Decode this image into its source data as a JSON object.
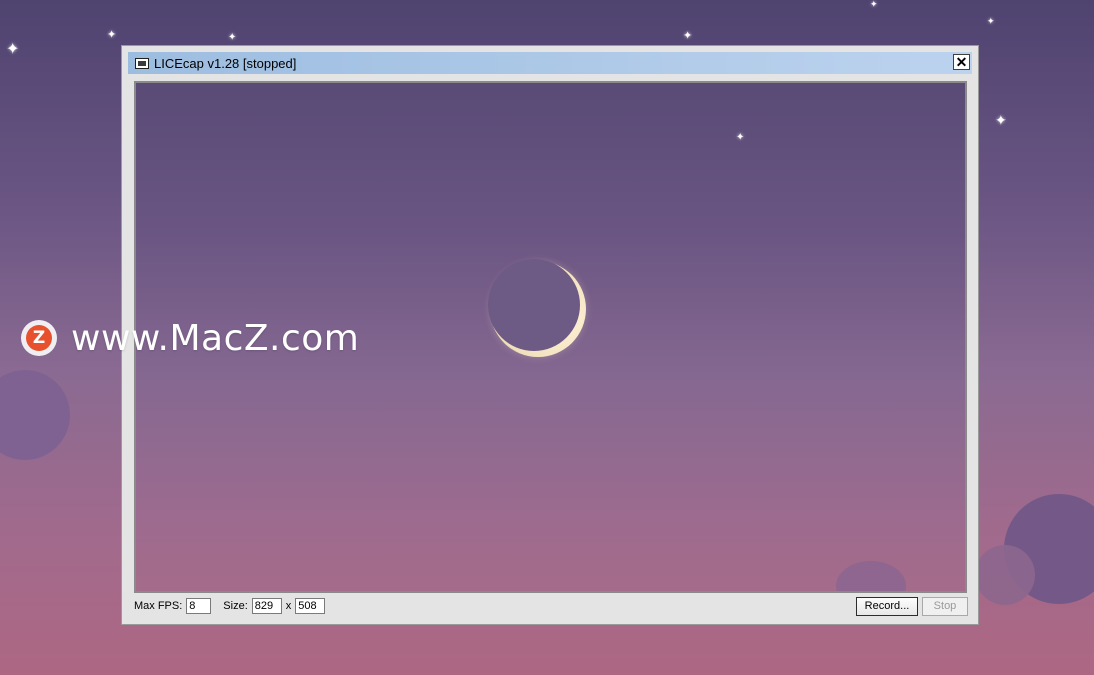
{
  "desktop": {
    "watermark_text": "www.MacZ.com",
    "watermark_logo_letter": "Z",
    "star_glyph": "✦",
    "moon_icon": "crescent-moon"
  },
  "window": {
    "title": "LICEcap v1.28 [stopped]",
    "app_icon": "monitor-icon",
    "close_label": "✕"
  },
  "controls": {
    "max_fps_label": "Max FPS:",
    "max_fps_value": "8",
    "size_label": "Size:",
    "width_value": "829",
    "times_label": "x",
    "height_value": "508",
    "record_label": "Record...",
    "stop_label": "Stop"
  },
  "colors": {
    "titlebar": "#9dbde0",
    "logo": "#e8512d",
    "moon": "#f3e6c6"
  }
}
